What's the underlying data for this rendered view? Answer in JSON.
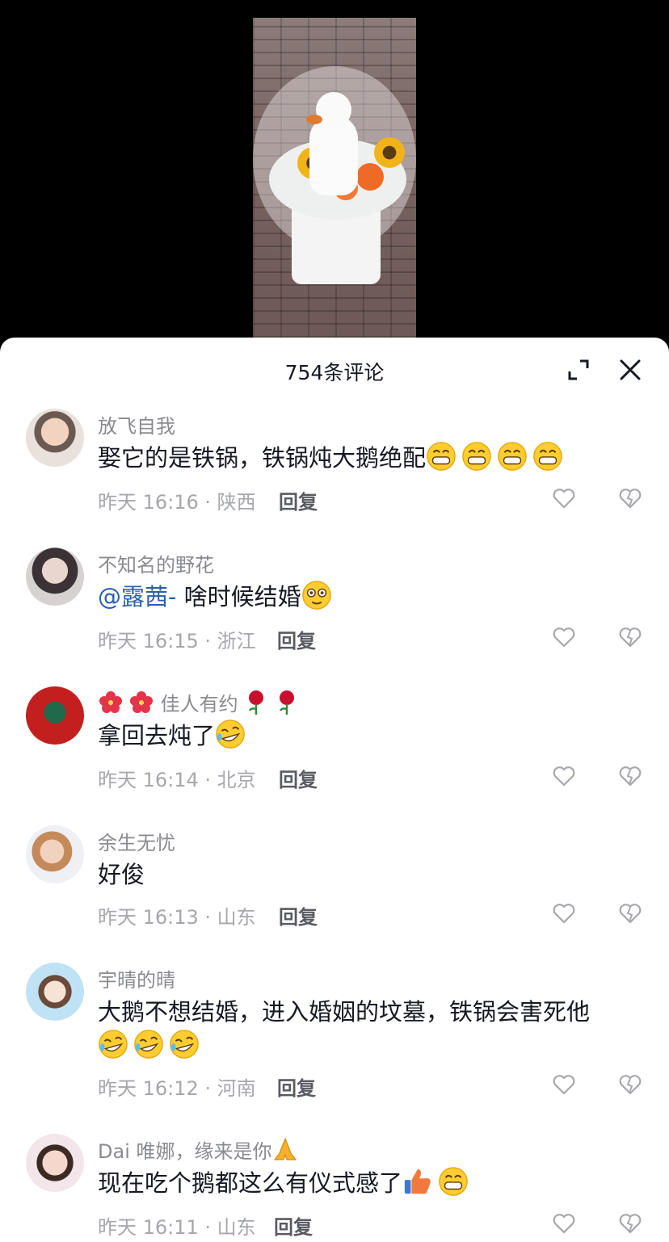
{
  "sheet": {
    "title": "754条评论"
  },
  "comments": [
    {
      "author": "放飞自我",
      "text": "娶它的是铁锅，铁锅炖大鹅绝配",
      "time_location": "昨天 16:16 · 陕西",
      "reply": "回复",
      "emojis": [
        "grin-emoji",
        "grin-emoji",
        "grin-emoji",
        "grin-emoji"
      ]
    },
    {
      "author": "不知名的野花",
      "mention": "@露茜-",
      "text": " 啥时候结婚",
      "time_location": "昨天 16:15 · 浙江",
      "reply": "回复",
      "emojis": [
        "flushed-emoji"
      ]
    },
    {
      "author": "佳人有约",
      "author_prefix_emojis": [
        "hibiscus-emoji",
        "hibiscus-emoji"
      ],
      "author_suffix_emojis": [
        "rose-emoji",
        "rose-emoji"
      ],
      "text": "拿回去炖了",
      "time_location": "昨天 16:14 · 北京",
      "reply": "回复",
      "emojis": [
        "rofl-emoji"
      ]
    },
    {
      "author": "余生无忧",
      "text": "好俊",
      "time_location": "昨天 16:13 · 山东",
      "reply": "回复"
    },
    {
      "author": "宇晴的晴",
      "text": "大鹅不想结婚，进入婚姻的坟墓，铁锅会害死他",
      "time_location": "昨天 16:12 · 河南",
      "reply": "回复",
      "emojis": [
        "rofl-emoji",
        "rofl-emoji",
        "rofl-emoji"
      ]
    },
    {
      "author": "Dai 唯娜，缘来是你",
      "author_suffix_emojis": [
        "pray-emoji"
      ],
      "text": "现在吃个鹅都这么有仪式感了",
      "time_location": "昨天 16:11 · 山东",
      "reply": "回复",
      "emojis": [
        "thumbs-up-emoji",
        "grin-emoji"
      ]
    }
  ],
  "colors": {
    "mention": "#2a5fab",
    "author": "#8a8b91",
    "text": "#161823",
    "meta": "#a6a7ad"
  }
}
